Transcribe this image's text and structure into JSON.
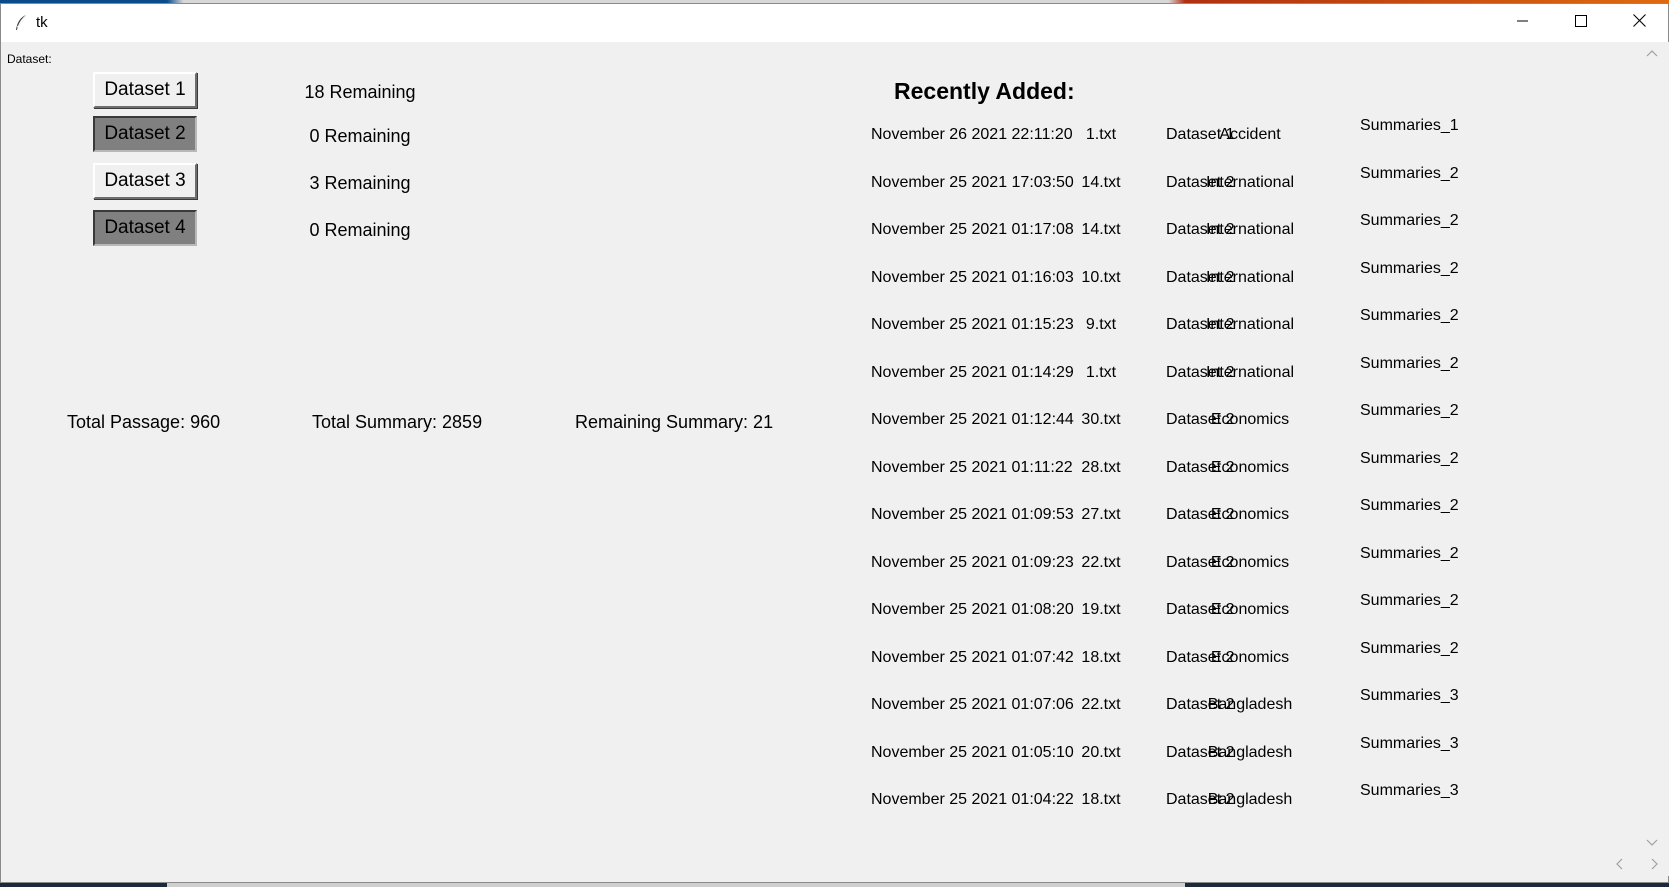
{
  "window": {
    "title": "tk"
  },
  "controls": {
    "dataset_label": "Dataset:"
  },
  "datasets": [
    {
      "label": "Dataset 1",
      "remaining": "18 Remaining",
      "state": "raised"
    },
    {
      "label": "Dataset 2",
      "remaining": "0 Remaining",
      "state": "sunken"
    },
    {
      "label": "Dataset 3",
      "remaining": "3 Remaining",
      "state": "raised"
    },
    {
      "label": "Dataset 4",
      "remaining": "0 Remaining",
      "state": "sunken"
    }
  ],
  "totals": {
    "passage": "Total Passage: 960",
    "summary": "Total Summary: 2859",
    "remaining": "Remaining Summary: 21"
  },
  "recent": {
    "title": "Recently Added:",
    "rows": [
      {
        "date": "November 26 2021 22:11:20",
        "file": "1.txt",
        "dataset": "Dataset 1",
        "category": "Accident",
        "summary": "Summaries_1"
      },
      {
        "date": "November 25 2021 17:03:50",
        "file": "14.txt",
        "dataset": "Dataset 2",
        "category": "International",
        "summary": "Summaries_2"
      },
      {
        "date": "November 25 2021 01:17:08",
        "file": "14.txt",
        "dataset": "Dataset 2",
        "category": "International",
        "summary": "Summaries_2"
      },
      {
        "date": "November 25 2021 01:16:03",
        "file": "10.txt",
        "dataset": "Dataset 2",
        "category": "International",
        "summary": "Summaries_2"
      },
      {
        "date": "November 25 2021 01:15:23",
        "file": "9.txt",
        "dataset": "Dataset 2",
        "category": "International",
        "summary": "Summaries_2"
      },
      {
        "date": "November 25 2021 01:14:29",
        "file": "1.txt",
        "dataset": "Dataset 2",
        "category": "International",
        "summary": "Summaries_2"
      },
      {
        "date": "November 25 2021 01:12:44",
        "file": "30.txt",
        "dataset": "Dataset 2",
        "category": "Economics",
        "summary": "Summaries_2"
      },
      {
        "date": "November 25 2021 01:11:22",
        "file": "28.txt",
        "dataset": "Dataset 2",
        "category": "Economics",
        "summary": "Summaries_2"
      },
      {
        "date": "November 25 2021 01:09:53",
        "file": "27.txt",
        "dataset": "Dataset 2",
        "category": "Economics",
        "summary": "Summaries_2"
      },
      {
        "date": "November 25 2021 01:09:23",
        "file": "22.txt",
        "dataset": "Dataset 2",
        "category": "Economics",
        "summary": "Summaries_2"
      },
      {
        "date": "November 25 2021 01:08:20",
        "file": "19.txt",
        "dataset": "Dataset 2",
        "category": "Economics",
        "summary": "Summaries_2"
      },
      {
        "date": "November 25 2021 01:07:42",
        "file": "18.txt",
        "dataset": "Dataset 2",
        "category": "Economics",
        "summary": "Summaries_2"
      },
      {
        "date": "November 25 2021 01:07:06",
        "file": "22.txt",
        "dataset": "Dataset 2",
        "category": "Bangladesh",
        "summary": "Summaries_3"
      },
      {
        "date": "November 25 2021 01:05:10",
        "file": "20.txt",
        "dataset": "Dataset 2",
        "category": "Bangladesh",
        "summary": "Summaries_3"
      },
      {
        "date": "November 25 2021 01:04:22",
        "file": "18.txt",
        "dataset": "Dataset 2",
        "category": "Bangladesh",
        "summary": "Summaries_3"
      }
    ]
  },
  "icons": {
    "app": "feather-icon",
    "minimize": "minimize-icon",
    "maximize": "maximize-icon",
    "close": "close-icon",
    "scroll_up": "chevron-up-icon",
    "scroll_down": "chevron-down-icon",
    "scroll_left": "chevron-left-icon",
    "scroll_right": "chevron-right-icon"
  }
}
